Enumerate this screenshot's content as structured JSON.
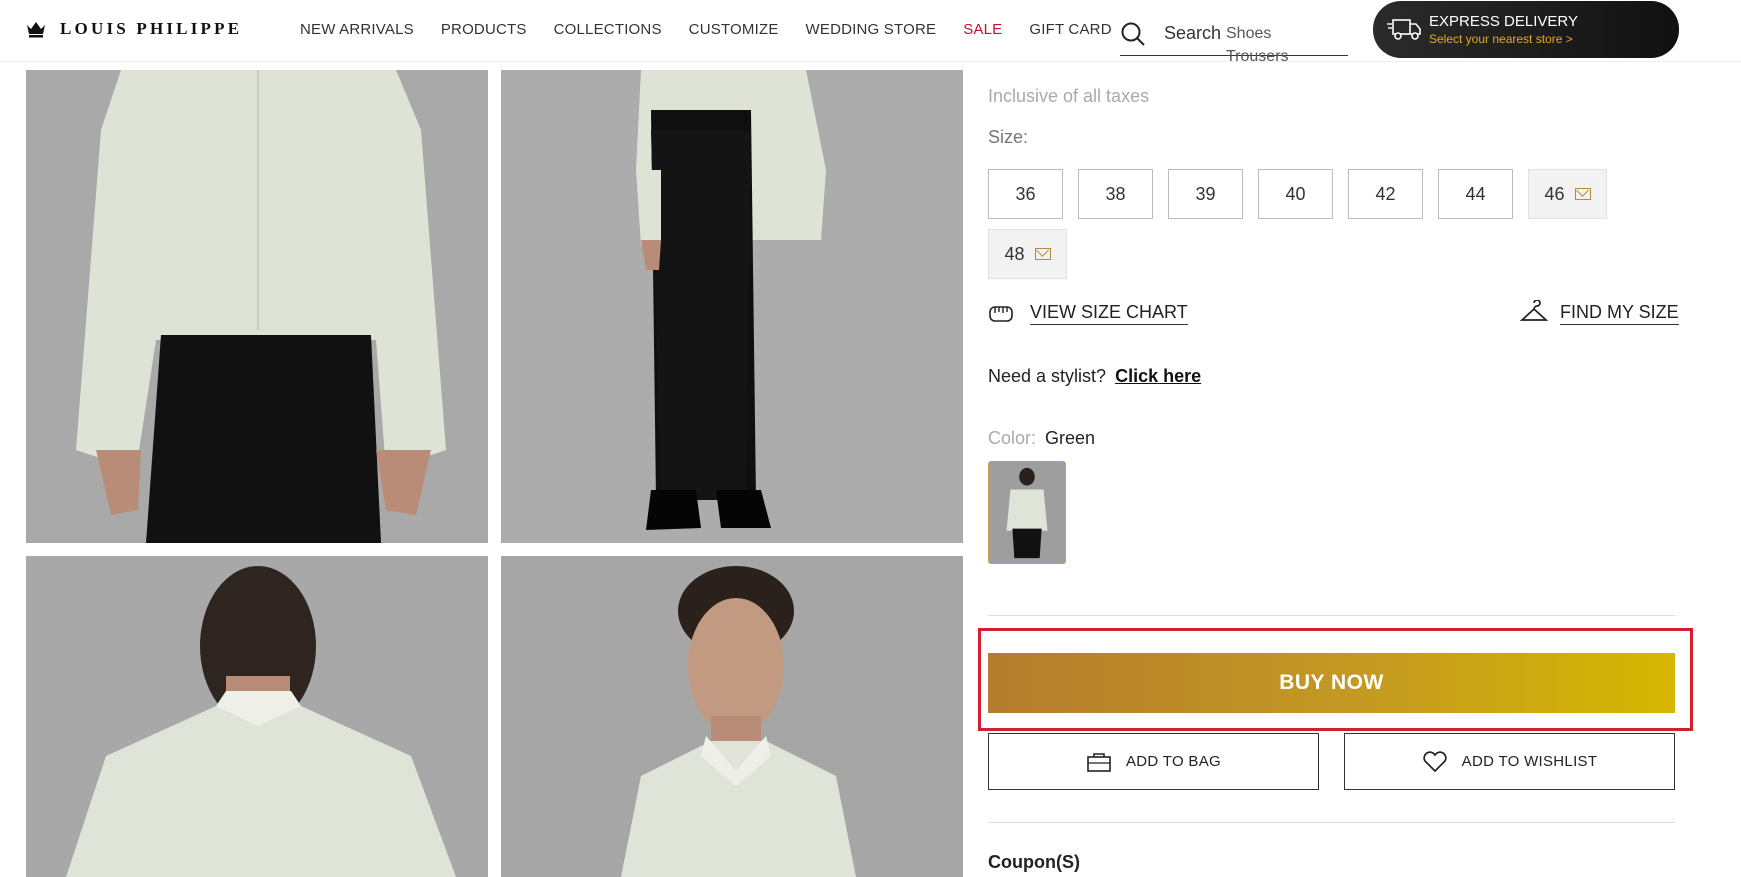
{
  "header": {
    "brand": "LOUIS PHILIPPE",
    "nav": [
      {
        "label": "NEW ARRIVALS"
      },
      {
        "label": "PRODUCTS"
      },
      {
        "label": "COLLECTIONS"
      },
      {
        "label": "CUSTOMIZE"
      },
      {
        "label": "WEDDING STORE"
      },
      {
        "label": "SALE"
      },
      {
        "label": "GIFT CARD"
      }
    ],
    "search": {
      "label": "Search",
      "suggestions": [
        "Shoes",
        "Trousers"
      ]
    },
    "express": {
      "title": "EXPRESS DELIVERY",
      "subtitle": "Select your nearest store >"
    }
  },
  "product": {
    "tax_note": "Inclusive of all taxes",
    "size_label": "Size:",
    "sizes": [
      {
        "label": "36",
        "available": true
      },
      {
        "label": "38",
        "available": true
      },
      {
        "label": "39",
        "available": true
      },
      {
        "label": "40",
        "available": true
      },
      {
        "label": "42",
        "available": true
      },
      {
        "label": "44",
        "available": true
      },
      {
        "label": "46",
        "available": false
      },
      {
        "label": "48",
        "available": false
      }
    ],
    "size_chart_link": "VIEW SIZE CHART",
    "find_size_link": "FIND MY SIZE",
    "stylist_text": "Need a stylist?",
    "stylist_link": "Click here",
    "color_label": "Color:",
    "color_value": "Green",
    "buy_now": "BUY NOW",
    "add_to_bag": "ADD TO BAG",
    "add_to_wishlist": "ADD TO WISHLIST",
    "coupons_heading": "Coupon(S)"
  },
  "colors": {
    "sale": "#c8102e",
    "accent_gold": "#c49a22",
    "highlight_red": "#d3202f",
    "express_text": "#e4a72b"
  }
}
